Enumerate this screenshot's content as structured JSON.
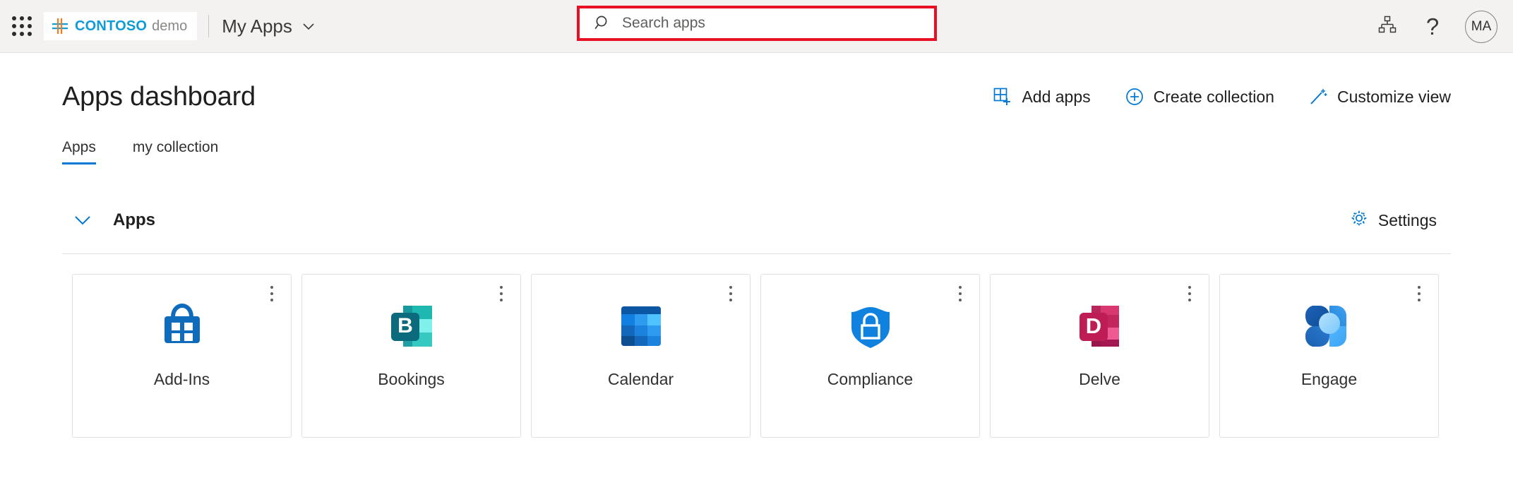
{
  "header": {
    "waffle_icon": "app-launcher-waffle-icon",
    "brand": {
      "logo_icon": "contoso-logo-icon",
      "name": "CONTOSO",
      "sub": "demo"
    },
    "myapps_label": "My Apps",
    "myapps_chevron_icon": "chevron-down-icon",
    "search": {
      "icon": "search-icon",
      "value": "",
      "placeholder": "Search apps",
      "highlight_color": "#e81123"
    },
    "org_icon": "org-hierarchy-icon",
    "help_label": "?",
    "avatar_initials": "MA"
  },
  "main": {
    "page_title": "Apps dashboard",
    "actions": [
      {
        "label": "Add apps",
        "icon": "add-apps-grid-plus-icon"
      },
      {
        "label": "Create collection",
        "icon": "circle-plus-icon"
      },
      {
        "label": "Customize view",
        "icon": "magic-wand-icon"
      }
    ],
    "tabs": [
      {
        "label": "Apps",
        "active": true
      },
      {
        "label": "my collection",
        "active": false
      }
    ],
    "section": {
      "title": "Apps",
      "collapse_icon": "chevron-down-icon",
      "settings_label": "Settings",
      "settings_icon": "gear-icon"
    },
    "cards": [
      {
        "label": "Add-Ins",
        "icon": "addins-store-bag-icon",
        "menu_icon": "more-options-icon"
      },
      {
        "label": "Bookings",
        "icon": "bookings-icon",
        "menu_icon": "more-options-icon"
      },
      {
        "label": "Calendar",
        "icon": "calendar-grid-icon",
        "menu_icon": "more-options-icon"
      },
      {
        "label": "Compliance",
        "icon": "shield-lock-icon",
        "menu_icon": "more-options-icon"
      },
      {
        "label": "Delve",
        "icon": "delve-icon",
        "menu_icon": "more-options-icon"
      },
      {
        "label": "Engage",
        "icon": "engage-petals-icon",
        "menu_icon": "more-options-icon"
      }
    ]
  },
  "colors": {
    "accent": "#0078d4",
    "header_bg": "#f3f2f1",
    "highlight": "#e81123",
    "brand_blue": "#0f9bd7",
    "brand_orange": "#f47b20"
  }
}
